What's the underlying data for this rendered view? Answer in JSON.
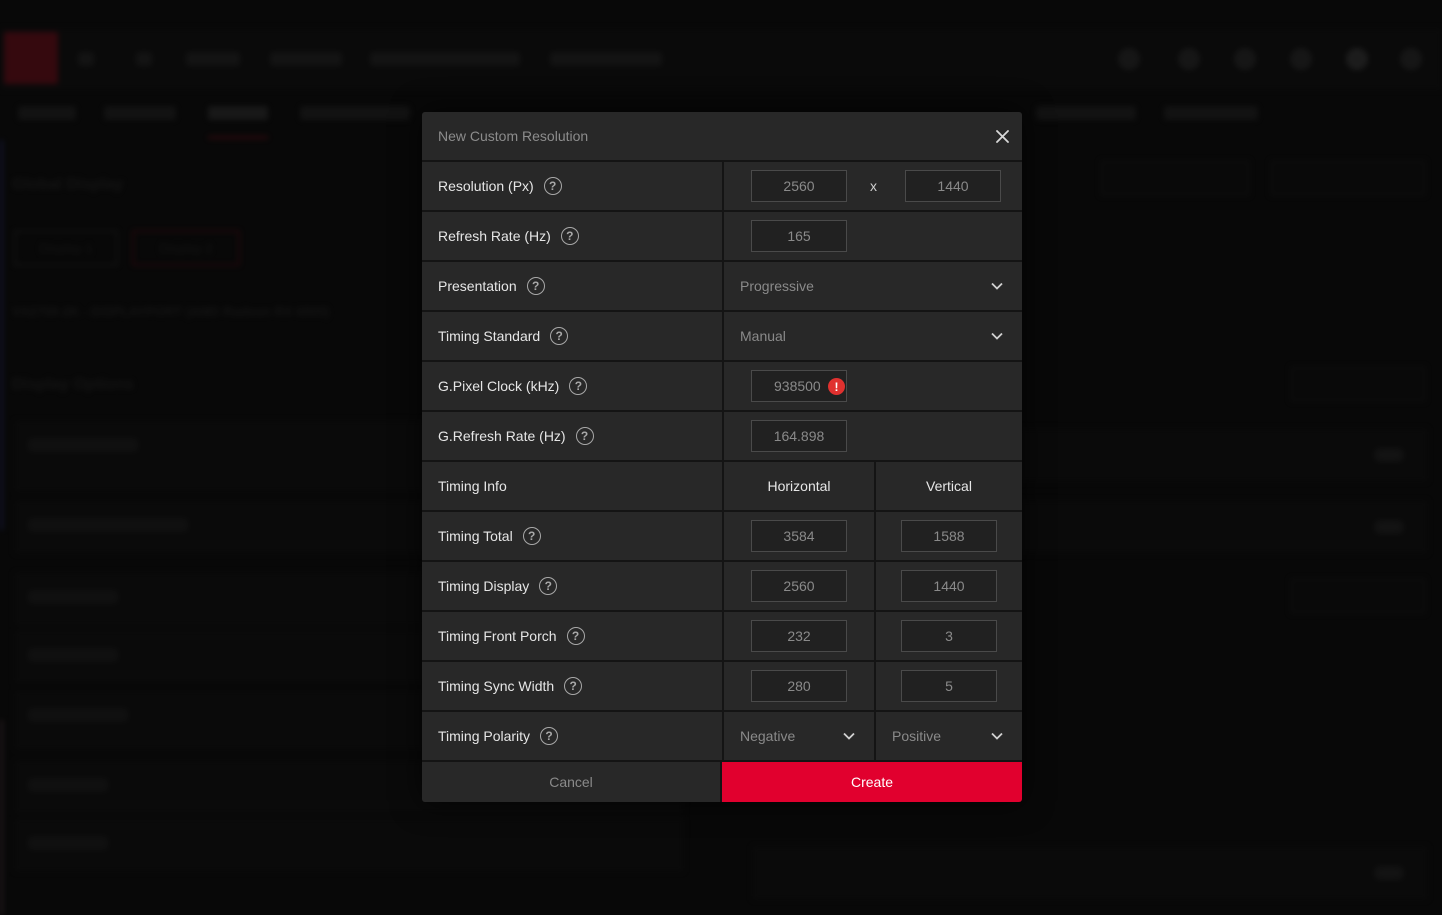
{
  "background": {
    "section_title": "Global Display",
    "display_tabs": [
      "Display 1",
      "Display 2"
    ],
    "active_display_tab": "Display 2",
    "monitor_name": "VX2758-2K - DISPLAYPORT (AMD Radeon RX 6800)",
    "options_title": "Display Options"
  },
  "dialog": {
    "title": "New Custom Resolution",
    "close_icon": "close-icon",
    "rows": {
      "resolution": {
        "label": "Resolution (Px)",
        "width": "2560",
        "separator": "x",
        "height": "1440"
      },
      "refresh_rate": {
        "label": "Refresh Rate (Hz)",
        "value": "165"
      },
      "presentation": {
        "label": "Presentation",
        "selected": "Progressive"
      },
      "timing_standard": {
        "label": "Timing Standard",
        "selected": "Manual"
      },
      "pixel_clock": {
        "label": "G.Pixel Clock (kHz)",
        "value": "938500",
        "error": true
      },
      "g_refresh_rate": {
        "label": "G.Refresh Rate (Hz)",
        "value": "164.898"
      },
      "timing_info": {
        "label": "Timing Info",
        "col_horizontal": "Horizontal",
        "col_vertical": "Vertical"
      },
      "timing_total": {
        "label": "Timing Total",
        "horizontal": "3584",
        "vertical": "1588"
      },
      "timing_display": {
        "label": "Timing Display",
        "horizontal": "2560",
        "vertical": "1440"
      },
      "timing_front_porch": {
        "label": "Timing Front Porch",
        "horizontal": "232",
        "vertical": "3"
      },
      "timing_sync_width": {
        "label": "Timing Sync Width",
        "horizontal": "280",
        "vertical": "5"
      },
      "timing_polarity": {
        "label": "Timing Polarity",
        "horizontal": "Negative",
        "vertical": "Positive"
      }
    },
    "help_glyph": "?",
    "error_glyph": "!",
    "cancel_label": "Cancel",
    "create_label": "Create"
  },
  "colors": {
    "accent": "#e1002e",
    "error": "#e0312f",
    "row_bg": "#282828",
    "input_bg": "#212121"
  }
}
